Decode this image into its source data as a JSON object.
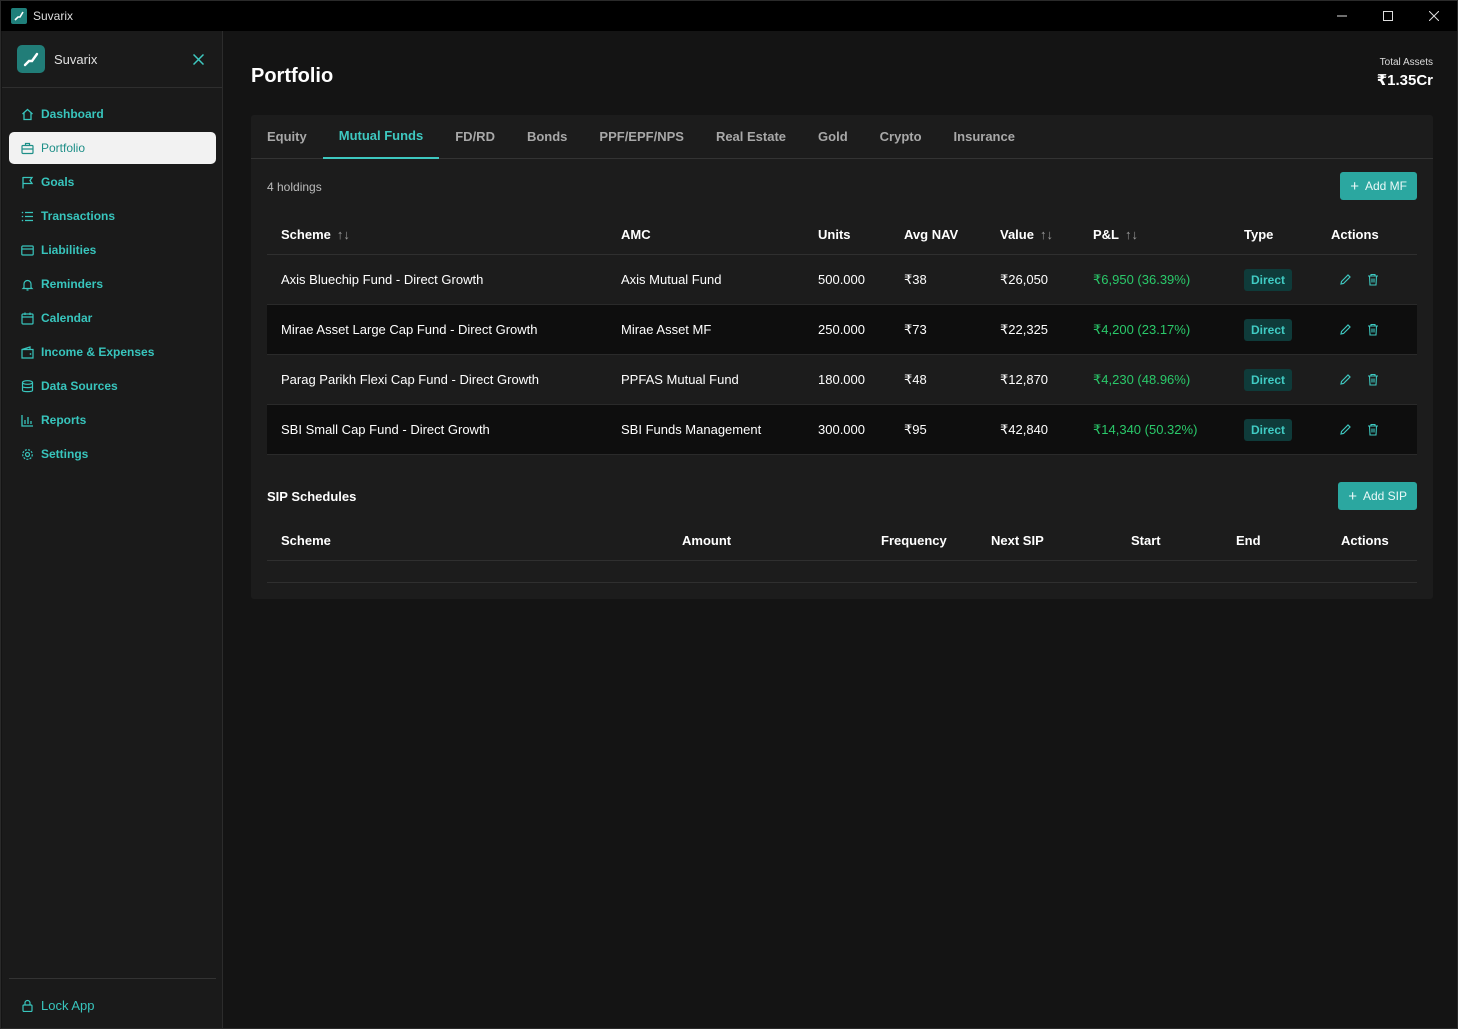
{
  "app": {
    "title": "Suvarix"
  },
  "sidebar": {
    "brand": "Suvarix",
    "items": [
      {
        "label": "Dashboard",
        "icon": "home-icon"
      },
      {
        "label": "Portfolio",
        "icon": "briefcase-icon"
      },
      {
        "label": "Goals",
        "icon": "flag-icon"
      },
      {
        "label": "Transactions",
        "icon": "list-icon"
      },
      {
        "label": "Liabilities",
        "icon": "card-icon"
      },
      {
        "label": "Reminders",
        "icon": "bell-icon"
      },
      {
        "label": "Calendar",
        "icon": "calendar-icon"
      },
      {
        "label": "Income & Expenses",
        "icon": "wallet-icon"
      },
      {
        "label": "Data Sources",
        "icon": "database-icon"
      },
      {
        "label": "Reports",
        "icon": "bar-chart-icon"
      },
      {
        "label": "Settings",
        "icon": "gear-icon"
      }
    ],
    "active_index": 1,
    "lock_label": "Lock App"
  },
  "header": {
    "title": "Portfolio",
    "total_label": "Total Assets",
    "total_value": "₹1.35Cr"
  },
  "tabs": [
    "Equity",
    "Mutual Funds",
    "FD/RD",
    "Bonds",
    "PPF/EPF/NPS",
    "Real Estate",
    "Gold",
    "Crypto",
    "Insurance"
  ],
  "active_tab": 1,
  "holdings": {
    "count_label": "4 holdings",
    "add_label": "Add MF",
    "columns": [
      "Scheme",
      "AMC",
      "Units",
      "Avg NAV",
      "Value",
      "P&L",
      "Type",
      "Actions"
    ],
    "rows": [
      {
        "scheme": "Axis Bluechip Fund - Direct Growth",
        "amc": "Axis Mutual Fund",
        "units": "500.000",
        "avg_nav": "₹38",
        "value": "₹26,050",
        "pl": "₹6,950 (36.39%)",
        "type": "Direct"
      },
      {
        "scheme": "Mirae Asset Large Cap Fund - Direct Growth",
        "amc": "Mirae Asset MF",
        "units": "250.000",
        "avg_nav": "₹73",
        "value": "₹22,325",
        "pl": "₹4,200 (23.17%)",
        "type": "Direct"
      },
      {
        "scheme": "Parag Parikh Flexi Cap Fund - Direct Growth",
        "amc": "PPFAS Mutual Fund",
        "units": "180.000",
        "avg_nav": "₹48",
        "value": "₹12,870",
        "pl": "₹4,230 (48.96%)",
        "type": "Direct"
      },
      {
        "scheme": "SBI Small Cap Fund - Direct Growth",
        "amc": "SBI Funds Management",
        "units": "300.000",
        "avg_nav": "₹95",
        "value": "₹42,840",
        "pl": "₹14,340 (50.32%)",
        "type": "Direct"
      }
    ]
  },
  "sip": {
    "title": "SIP Schedules",
    "add_label": "Add SIP",
    "columns": [
      "Scheme",
      "Amount",
      "Frequency",
      "Next SIP",
      "Start",
      "End",
      "Actions"
    ]
  },
  "colors": {
    "accent": "#3ec8c0",
    "positive": "#2ac96a",
    "button": "#2ba7a0"
  }
}
